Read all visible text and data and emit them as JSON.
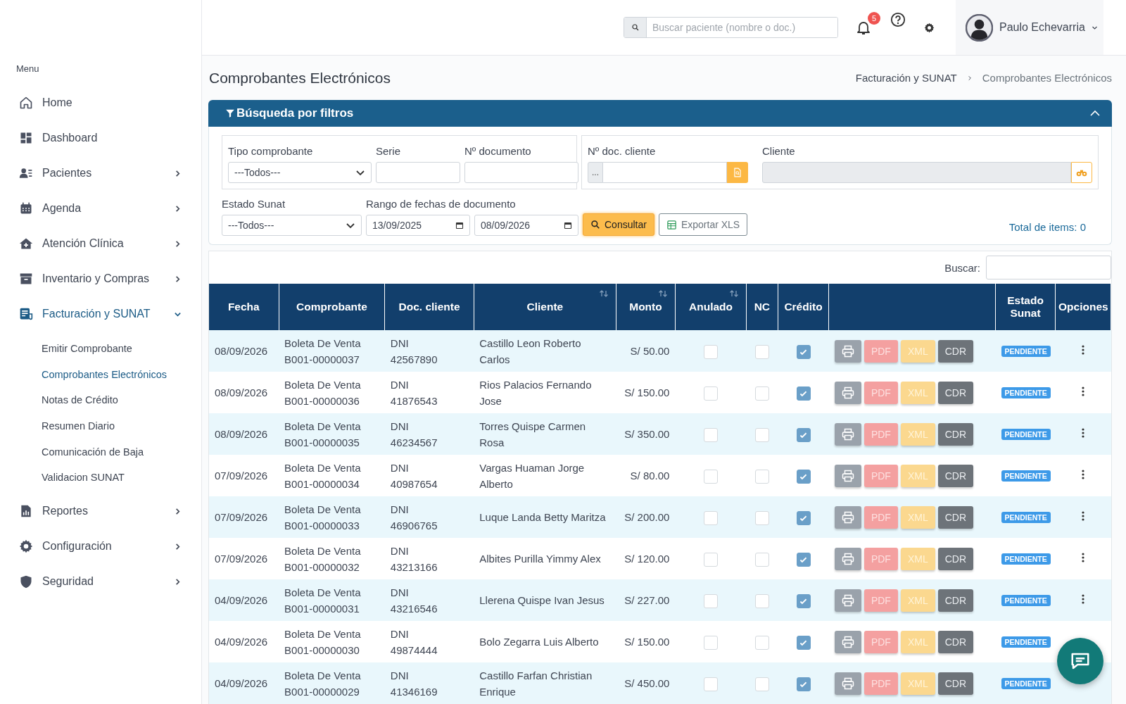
{
  "sidebar": {
    "menu_label": "Menu",
    "items": [
      {
        "label": "Home",
        "kind": "home",
        "selected": false
      },
      {
        "label": "Dashboard",
        "kind": "dashboard",
        "selected": false
      },
      {
        "label": "Pacientes",
        "kind": "patients",
        "expanded": false,
        "selected": false
      },
      {
        "label": "Agenda",
        "kind": "calendar",
        "expanded": false,
        "selected": false
      },
      {
        "label": "Atención Clínica",
        "kind": "clinic",
        "expanded": false,
        "selected": false
      },
      {
        "label": "Inventario y Compras",
        "kind": "archive",
        "expanded": false,
        "selected": false
      },
      {
        "label": "Facturación y SUNAT",
        "kind": "invoice",
        "expanded": true,
        "selected": true,
        "children": [
          {
            "label": "Emitir Comprobante",
            "selected": false
          },
          {
            "label": "Comprobantes Electrónicos",
            "selected": true
          },
          {
            "label": "Notas de Crédito",
            "selected": false
          },
          {
            "label": "Resumen Diario",
            "selected": false
          },
          {
            "label": "Comunicación de Baja",
            "selected": false
          },
          {
            "label": "Validacion SUNAT",
            "selected": false
          }
        ]
      },
      {
        "label": "Reportes",
        "kind": "report",
        "expanded": false,
        "selected": false
      },
      {
        "label": "Configuración",
        "kind": "gear",
        "expanded": false,
        "selected": false
      },
      {
        "label": "Seguridad",
        "kind": "shield",
        "expanded": false,
        "selected": false
      }
    ]
  },
  "topbar": {
    "search": {
      "placeholder": "Buscar paciente (nombre o doc.)"
    },
    "notifications": "5",
    "user": "Paulo Echevarria"
  },
  "page": {
    "title": "Comprobantes Electrónicos",
    "breadcrumb": [
      "Facturación y SUNAT",
      "Comprobantes Electrónicos"
    ]
  },
  "filters": {
    "title": "Búsqueda por filtros",
    "expanded": true,
    "tipo_comprobante": {
      "label": "Tipo comprobante",
      "value": "---Todos---"
    },
    "serie": {
      "label": "Serie"
    },
    "numero": {
      "label": "Nº documento"
    },
    "doc_cliente": {
      "label": "Nº doc. cliente",
      "prefix": "..."
    },
    "cliente": {
      "label": "Cliente"
    },
    "estado": {
      "label": "Estado Sunat",
      "value": "---Todos---"
    },
    "rango": {
      "label": "Rango de fechas de documento",
      "desde": "13/09/2025",
      "hasta": "08/09/2026"
    },
    "consultar": "Consultar",
    "exportar": "Exportar XLS",
    "total": "Total de items: 0"
  },
  "table": {
    "search_label": "Buscar:",
    "columns": [
      {
        "label": "Fecha",
        "sortable": false
      },
      {
        "label": "Comprobante",
        "sortable": false
      },
      {
        "label": "Doc. cliente",
        "sortable": false
      },
      {
        "label": "Cliente",
        "sortable": true
      },
      {
        "label": "Monto",
        "sortable": true
      },
      {
        "label": "Anulado",
        "sortable": true
      },
      {
        "label": "NC",
        "sortable": false
      },
      {
        "label": "Crédito",
        "sortable": false
      },
      {
        "sortable": false
      },
      {
        "label": "Estado Sunat",
        "sortable": false
      },
      {
        "label": "Opciones",
        "sortable": false
      }
    ],
    "rows": [
      {
        "fecha": "08/09/2026",
        "tipo": "Boleta De Venta",
        "numero": "B001-00000037",
        "doc_tipo": "DNI",
        "doc_numero": "42567890",
        "cliente": "Castillo Leon Roberto Carlos",
        "monto": "S/ 50.00",
        "anulado": false,
        "nc": false,
        "credito": true,
        "actions": [
          "PDF",
          "XML",
          "CDR"
        ],
        "estado": "PENDIENTE"
      },
      {
        "fecha": "08/09/2026",
        "tipo": "Boleta De Venta",
        "numero": "B001-00000036",
        "doc_tipo": "DNI",
        "doc_numero": "41876543",
        "cliente": "Rios Palacios Fernando Jose",
        "monto": "S/ 150.00",
        "anulado": false,
        "nc": false,
        "credito": true,
        "actions": [
          "PDF",
          "XML",
          "CDR"
        ],
        "estado": "PENDIENTE"
      },
      {
        "fecha": "08/09/2026",
        "tipo": "Boleta De Venta",
        "numero": "B001-00000035",
        "doc_tipo": "DNI",
        "doc_numero": "46234567",
        "cliente": "Torres Quispe Carmen Rosa",
        "monto": "S/ 350.00",
        "anulado": false,
        "nc": false,
        "credito": true,
        "actions": [
          "PDF",
          "XML",
          "CDR"
        ],
        "estado": "PENDIENTE"
      },
      {
        "fecha": "07/09/2026",
        "tipo": "Boleta De Venta",
        "numero": "B001-00000034",
        "doc_tipo": "DNI",
        "doc_numero": "40987654",
        "cliente": "Vargas Huaman Jorge Alberto",
        "monto": "S/ 80.00",
        "anulado": false,
        "nc": false,
        "credito": true,
        "actions": [
          "PDF",
          "XML",
          "CDR"
        ],
        "estado": "PENDIENTE"
      },
      {
        "fecha": "07/09/2026",
        "tipo": "Boleta De Venta",
        "numero": "B001-00000033",
        "doc_tipo": "DNI",
        "doc_numero": "46906765",
        "cliente": "Luque Landa Betty Maritza",
        "monto": "S/ 200.00",
        "anulado": false,
        "nc": false,
        "credito": true,
        "actions": [
          "PDF",
          "XML",
          "CDR"
        ],
        "estado": "PENDIENTE"
      },
      {
        "fecha": "07/09/2026",
        "tipo": "Boleta De Venta",
        "numero": "B001-00000032",
        "doc_tipo": "DNI",
        "doc_numero": "43213166",
        "cliente": "Albites Purilla Yimmy Alex",
        "monto": "S/ 120.00",
        "anulado": false,
        "nc": false,
        "credito": true,
        "actions": [
          "PDF",
          "XML",
          "CDR"
        ],
        "estado": "PENDIENTE"
      },
      {
        "fecha": "04/09/2026",
        "tipo": "Boleta De Venta",
        "numero": "B001-00000031",
        "doc_tipo": "DNI",
        "doc_numero": "43216546",
        "cliente": "Llerena Quispe Ivan Jesus",
        "monto": "S/ 227.00",
        "anulado": false,
        "nc": false,
        "credito": true,
        "actions": [
          "PDF",
          "XML",
          "CDR"
        ],
        "estado": "PENDIENTE"
      },
      {
        "fecha": "04/09/2026",
        "tipo": "Boleta De Venta",
        "numero": "B001-00000030",
        "doc_tipo": "DNI",
        "doc_numero": "49874444",
        "cliente": "Bolo Zegarra Luis Alberto",
        "monto": "S/ 150.00",
        "anulado": false,
        "nc": false,
        "credito": true,
        "actions": [
          "PDF",
          "XML",
          "CDR"
        ],
        "estado": "PENDIENTE"
      },
      {
        "fecha": "04/09/2026",
        "tipo": "Boleta De Venta",
        "numero": "B001-00000029",
        "doc_tipo": "DNI",
        "doc_numero": "41346169",
        "cliente": "Castillo Farfan Christian Enrique",
        "monto": "S/ 450.00",
        "anulado": false,
        "nc": false,
        "credito": true,
        "actions": [
          "PDF",
          "XML",
          "CDR"
        ],
        "estado": "PENDIENTE"
      }
    ]
  }
}
